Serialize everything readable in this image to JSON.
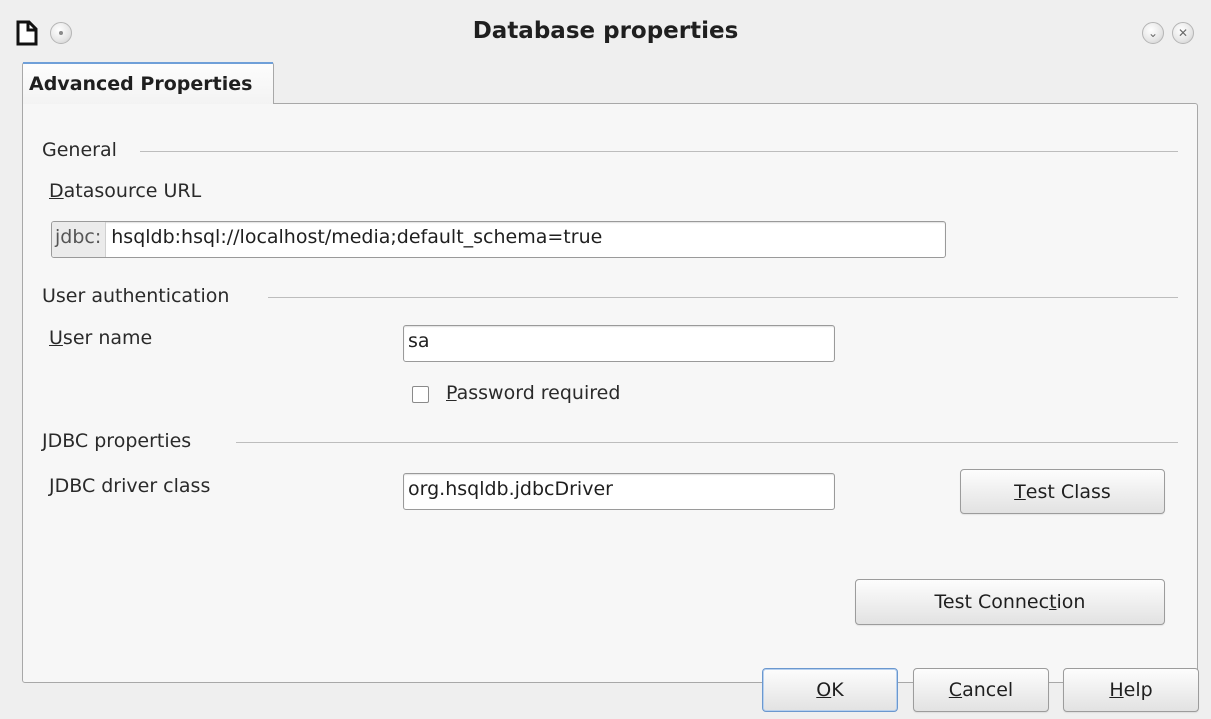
{
  "window": {
    "title": "Database properties",
    "icons": [
      "document-app-icon",
      "window-menu-icon",
      "minimize-icon",
      "close-icon"
    ]
  },
  "tabs": [
    {
      "label": "Advanced Properties",
      "active": true
    }
  ],
  "general": {
    "section_title": "General",
    "url_label_first": "D",
    "url_label_rest": "atasource URL",
    "url_prefix": "jdbc:",
    "url_value": "hsqldb:hsql://localhost/media;default_schema=true"
  },
  "auth": {
    "section_title": "User authentication",
    "user_label_first": "U",
    "user_label_rest": "ser name",
    "user_value": "sa",
    "password_label_first": "P",
    "password_label_rest": "assword required",
    "password_required": false
  },
  "jdbc": {
    "section_title": "JDBC properties",
    "driver_label_first": "J",
    "driver_label_rest": "DBC driver class",
    "driver_value": "org.hsqldb.jdbcDriver",
    "test_class_first": "T",
    "test_class_rest": "est Class",
    "test_conn_pre": "Test Connec",
    "test_conn_u": "t",
    "test_conn_post": "ion"
  },
  "footer": {
    "ok_u": "O",
    "ok_rest": "K",
    "cancel_u": "C",
    "cancel_rest": "ancel",
    "help_u": "H",
    "help_rest": "elp"
  },
  "colors": {
    "accent": "#6f9fd8",
    "background": "#efefef",
    "panel": "#f7f7f7"
  }
}
